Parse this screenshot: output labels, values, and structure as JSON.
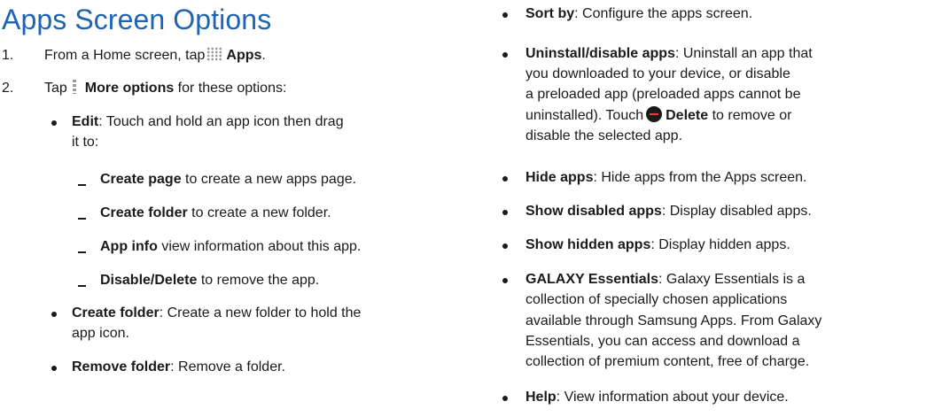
{
  "title": "Apps Screen Options",
  "step1": {
    "num": "1.",
    "text": "From a Home screen, tap",
    "icon": "apps-grid-icon",
    "bold": "Apps",
    "end": "."
  },
  "step2": {
    "num": "2.",
    "text": "Tap",
    "icon": "more-options-icon",
    "bold": "More options",
    "end": " for these options:"
  },
  "edit": {
    "bold": "Edit",
    "line1": ": Touch and hold an app icon then drag",
    "line2": "it to:"
  },
  "edit_sub": [
    {
      "bold": "Create page",
      "rest": " to create a new apps page."
    },
    {
      "bold": "Create folder",
      "rest": " to create a new folder."
    },
    {
      "bold": "App info",
      "rest": " view information about this app."
    },
    {
      "bold": "Disable/Delete",
      "rest": " to remove the app."
    }
  ],
  "create_folder": {
    "bold": "Create folder",
    "line1": ": Create a new folder to hold the",
    "line2": "app icon."
  },
  "remove_folder": {
    "bold": "Remove folder",
    "rest": ": Remove a folder."
  },
  "sort_by": {
    "bold": "Sort by",
    "rest": ": Configure the apps screen."
  },
  "uninstall": {
    "bold": "Uninstall/disable apps",
    "line1": ": Uninstall an app that",
    "line2": "you downloaded to your device, or disable",
    "line3": "a preloaded app (preloaded apps cannot be",
    "line4a": "uninstalled). Touch",
    "icon": "delete-icon",
    "line4bold": "Delete",
    "line4b": " to remove or",
    "line5": "disable the selected app."
  },
  "hide_apps": {
    "bold": "Hide apps",
    "rest": ": Hide apps from the Apps screen."
  },
  "show_disabled": {
    "bold": "Show disabled apps",
    "rest": ": Display disabled apps."
  },
  "show_hidden": {
    "bold": "Show hidden apps",
    "rest": ": Display hidden apps."
  },
  "galaxy": {
    "bold": "GALAXY Essentials",
    "line1": ": Galaxy Essentials is a",
    "line2": "collection of specially chosen applications",
    "line3": "available through Samsung Apps. From Galaxy",
    "line4": "Essentials, you can access and download a",
    "line5": "collection of premium content, free of charge."
  },
  "help": {
    "bold": "Help",
    "rest": ": View information about your device."
  },
  "colors": {
    "title": "#1f64b4",
    "text": "#1a1a1a"
  }
}
